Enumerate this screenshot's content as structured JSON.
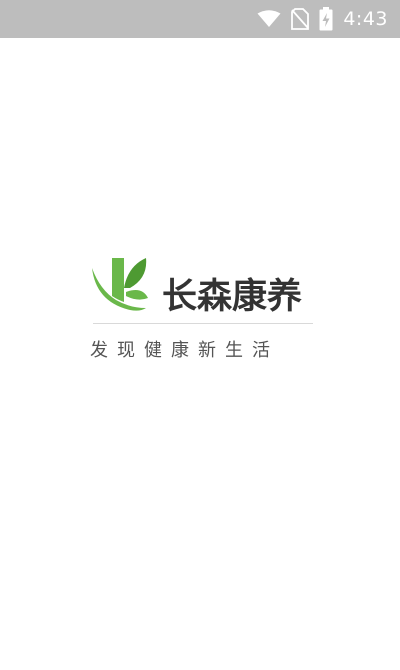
{
  "status_bar": {
    "time": "4:43",
    "icons": [
      "wifi-icon",
      "no-sim-icon",
      "battery-charging-icon"
    ]
  },
  "splash": {
    "brand_name": "长森康养",
    "slogan": "发现健康新生活",
    "logo_icon": "leaf-k-logo-icon",
    "colors": {
      "brand_green": "#6ab84a",
      "leaf_dark_green": "#4e9a32",
      "text_dark": "#333333",
      "status_bar_bg": "#bdbdbd"
    }
  }
}
